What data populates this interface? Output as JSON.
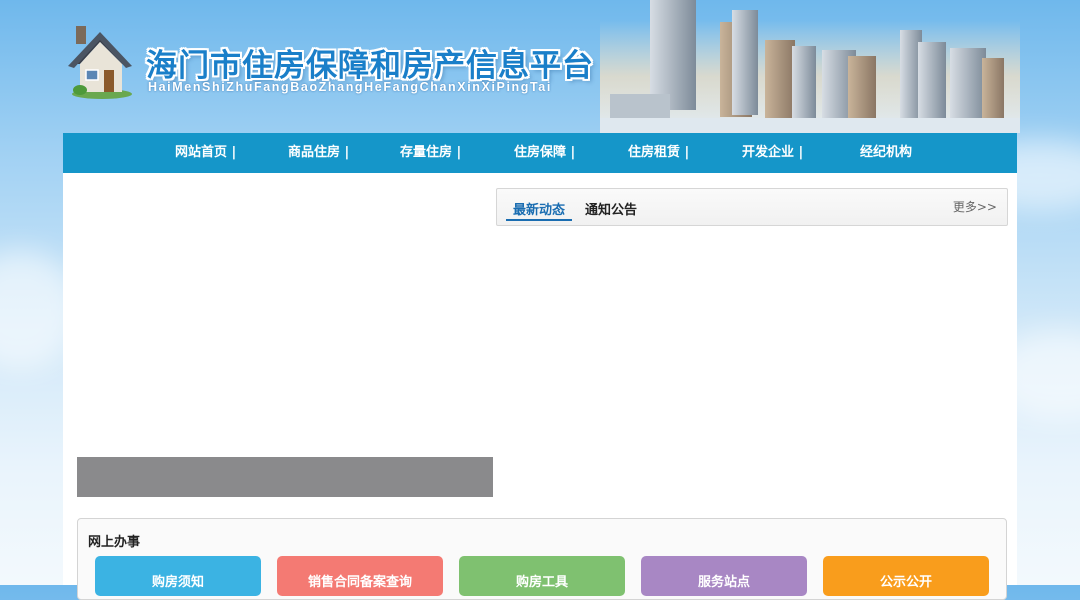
{
  "header": {
    "title": "海门市住房保障和房产信息平台",
    "subtitle": "HaiMenShiZhuFangBaoZhangHeFangChanXinXiPingTai"
  },
  "nav": {
    "items": [
      {
        "label": "网站首页 |"
      },
      {
        "label": "商品住房 |"
      },
      {
        "label": "存量住房 |"
      },
      {
        "label": "住房保障 |"
      },
      {
        "label": "住房租赁 |"
      },
      {
        "label": "开发企业 |"
      },
      {
        "label": "经纪机构"
      }
    ]
  },
  "news": {
    "tabs": [
      {
        "label": "最新动态"
      },
      {
        "label": "通知公告"
      }
    ],
    "more_label": "更多>>"
  },
  "online_services": {
    "title": "网上办事",
    "buttons": [
      {
        "label": "购房须知",
        "color": "#3bb3e3"
      },
      {
        "label": "销售合同备案查询",
        "color": "#f47a73"
      },
      {
        "label": "购房工具",
        "color": "#7fc170"
      },
      {
        "label": "服务站点",
        "color": "#a887c4"
      },
      {
        "label": "公示公开",
        "color": "#f99d1c"
      }
    ]
  },
  "colors": {
    "nav_bg": "#1596c9",
    "accent": "#1a6db1"
  }
}
